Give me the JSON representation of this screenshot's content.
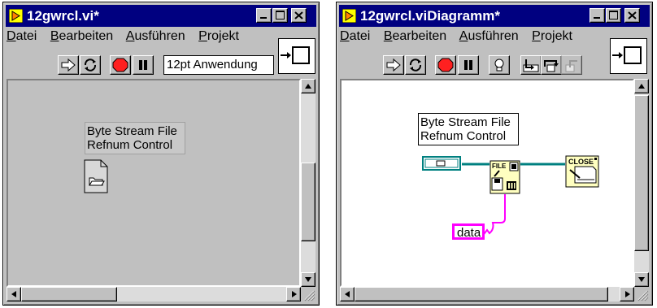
{
  "front_panel": {
    "title": "12gwrcl.vi*",
    "menu": [
      "Datei",
      "Bearbeiten",
      "Ausführen",
      "Projekt"
    ],
    "font_selector": "12pt Anwendung",
    "control_label_line1": "Byte Stream File",
    "control_label_line2": "Refnum Control"
  },
  "diagram": {
    "title": "12gwrcl.viDiagramm*",
    "menu": [
      "Datei",
      "Bearbeiten",
      "Ausführen",
      "Projekt"
    ],
    "terminal_label_line1": "Byte Stream File",
    "terminal_label_line2": "Refnum Control",
    "write_node_text": "FILE",
    "close_node_text": "CLOSE",
    "data_constant": "data"
  },
  "colors": {
    "titlebar": "#000080",
    "panel_bg": "#c0c0c0",
    "diagram_bg": "#ffffff",
    "wire_refnum": "#008080",
    "wire_string": "#ff00ff",
    "node_fill": "#ffffc0"
  }
}
